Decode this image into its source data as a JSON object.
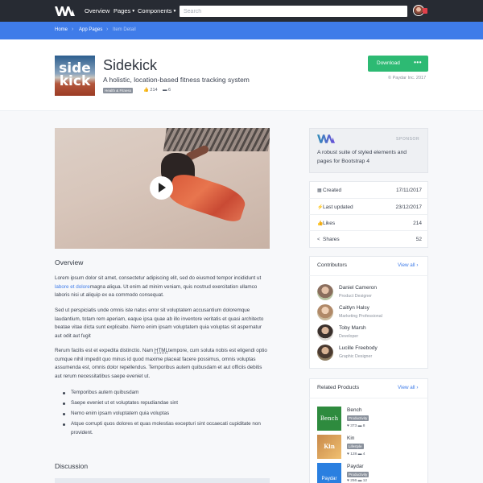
{
  "navbar": {
    "links": [
      {
        "label": "Overview"
      },
      {
        "label": "Pages"
      },
      {
        "label": "Components"
      }
    ],
    "search_placeholder": "Search"
  },
  "breadcrumb": [
    "Home",
    "App Pages",
    "Item Detail"
  ],
  "product": {
    "thumb_text": [
      "side",
      "kick"
    ],
    "title": "Sidekick",
    "subtitle": "A holistic, location-based fitness tracking system",
    "category": "Health & Fitness",
    "likes": "214",
    "comments": "6",
    "download_label": "Download",
    "more_label": "•••",
    "copyright": "© Paydar Inc. 2017"
  },
  "overview": {
    "heading": "Overview",
    "p1_before": "Lorem ipsum dolor sit amet, consectetur adipiscing elit, sed do eiusmod tempor incididunt ut ",
    "p1_link": "labore et dolore",
    "p1_after": "magna aliqua. Ut enim ad minim veniam, quis nostrud exercitation ullamco laboris nisi ut aliquip ex ea commodo consequat.",
    "p2": "Sed ut perspiciatis unde omnis iste natus error sit voluptatem accusantium doloremque laudantium, totam rem aperiam, eaque ipsa quae ab illo inventore veritatis et quasi architecto beatae vitae dicta sunt explicabo. Nemo enim ipsam voluptatem quia voluptas sit aspernatur aut odit aut fugit",
    "p3_before": "Rerum facilis est et expedita distinctio. Nam ",
    "p3_abbr": "HTML",
    "p3_after": "tempore, cum soluta nobis est eligendi optio cumque nihil impedit quo minus id quod maxime placeat facere possimus, omnis voluptas assumenda est, omnis dolor repellendus. Temporibus autem quibusdam et aut officiis debitis aut rerum necessitatibus saepe eveniet ut.",
    "bullets": [
      "Temporibus autem quibusdam",
      "Saepe eveniet ut et voluptates repudiandae sint",
      "Nemo enim ipsam voluptatem quia voluptas",
      "Atque corrupti quos dolores et quas molestias excepturi sint occaecati cupiditate non provident."
    ]
  },
  "discussion": {
    "heading": "Discussion"
  },
  "sponsor": {
    "tag": "SPONSOR",
    "text": "A robust suite of styled elements and pages for Bootstrap 4"
  },
  "meta": [
    {
      "icon": "calendar-icon",
      "glyph": "▦",
      "label": "Created",
      "value": "17/11/2017"
    },
    {
      "icon": "bolt-icon",
      "glyph": "⚡",
      "label": "Last updated",
      "value": "23/12/2017"
    },
    {
      "icon": "thumbs-up-icon",
      "glyph": "👍",
      "label": "Likes",
      "value": "214"
    },
    {
      "icon": "share-icon",
      "glyph": "<",
      "label": "Shares",
      "value": "52"
    }
  ],
  "contributors": {
    "heading": "Contributors",
    "view_all": "View all ›",
    "people": [
      {
        "name": "Daniel Cameron",
        "role": "Product Designer",
        "color": "#8a6e5d"
      },
      {
        "name": "Caitlyn Halsy",
        "role": "Marketing Professional",
        "color": "#b08968"
      },
      {
        "name": "Toby Marsh",
        "role": "Developer",
        "color": "#5a4a44"
      },
      {
        "name": "Lucille Freebody",
        "role": "Graphic Designer",
        "color": "#6b5444"
      }
    ]
  },
  "related": {
    "heading": "Related Products",
    "view_all": "View all ›",
    "items": [
      {
        "name": "Bench",
        "category": "Productivity",
        "thumb_text": "Bench",
        "color": "#2e8b3e",
        "likes": "373",
        "comments": "8"
      },
      {
        "name": "Kin",
        "category": "Lifestyle",
        "thumb_text": "Kin",
        "color": "#e0a24a",
        "likes": "128",
        "comments": "4"
      },
      {
        "name": "Paydar",
        "category": "Productivity",
        "thumb_text": "Paydar",
        "color": "#2a7fe0",
        "likes": "256",
        "comments": "12"
      }
    ]
  },
  "colors": {
    "primary": "#3f7ce9",
    "success": "#2dba73",
    "navbar": "#272b33"
  }
}
